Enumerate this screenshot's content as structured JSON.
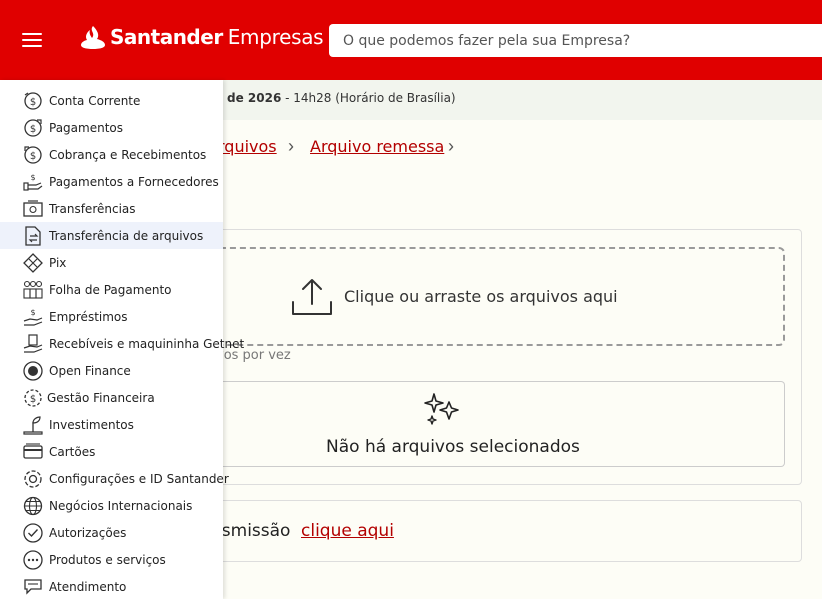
{
  "header": {
    "brand": "Santander",
    "brand_sub": "Empresas",
    "search_placeholder": "O que podemos fazer pela sua Empresa?",
    "accent_color": "#e00000"
  },
  "infobar": {
    "date_bold": "de 2026",
    "time_text": " - 14h28 (Horário de Brasília)"
  },
  "breadcrumb": {
    "items": [
      "rquivos",
      "Arquivo remessa"
    ]
  },
  "upload": {
    "drop_text": "Clique ou arraste os arquivos aqui",
    "hint": "vos por vez",
    "empty_text": "Não há arquivos selecionados"
  },
  "transmission": {
    "text": "nsmissão",
    "link": "clique aqui"
  },
  "menu": {
    "items": [
      {
        "label": "Conta Corrente",
        "icon": "money-coin-icon"
      },
      {
        "label": "Pagamentos",
        "icon": "payment-icon"
      },
      {
        "label": "Cobrança e Recebimentos",
        "icon": "billing-icon"
      },
      {
        "label": "Pagamentos a Fornecedores",
        "icon": "supplier-payment-icon"
      },
      {
        "label": "Transferências",
        "icon": "transfer-icon"
      },
      {
        "label": "Transferência de arquivos",
        "icon": "file-transfer-icon"
      },
      {
        "label": "Pix",
        "icon": "pix-icon"
      },
      {
        "label": "Folha de Pagamento",
        "icon": "payroll-icon"
      },
      {
        "label": "Empréstimos",
        "icon": "loan-icon"
      },
      {
        "label": "Recebíveis e maquininha Getnet",
        "icon": "receivables-icon"
      },
      {
        "label": "Open Finance",
        "icon": "open-finance-icon"
      },
      {
        "label": "Gestão Financeira",
        "icon": "financial-management-icon"
      },
      {
        "label": "Investimentos",
        "icon": "investment-icon"
      },
      {
        "label": "Cartões",
        "icon": "card-icon"
      },
      {
        "label": "Configurações e ID Santander",
        "icon": "settings-icon"
      },
      {
        "label": "Negócios Internacionais",
        "icon": "globe-icon"
      },
      {
        "label": "Autorizações",
        "icon": "check-circle-icon"
      },
      {
        "label": "Produtos e serviços",
        "icon": "more-circle-icon"
      },
      {
        "label": "Atendimento",
        "icon": "chat-icon"
      }
    ]
  }
}
